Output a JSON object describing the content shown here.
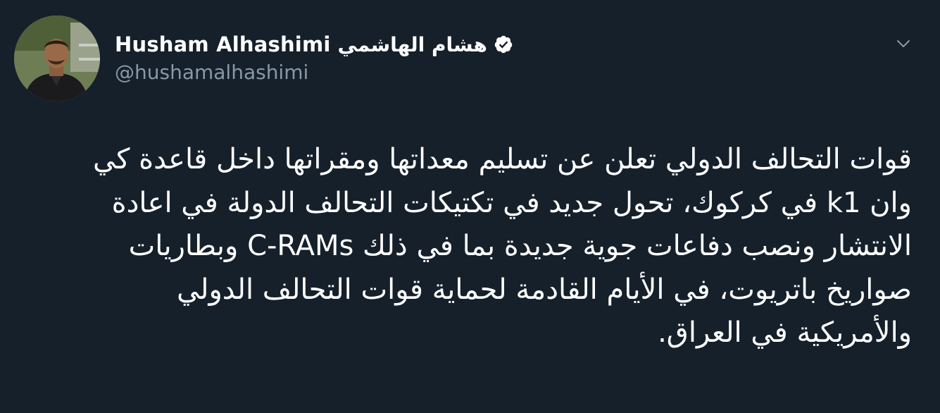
{
  "tweet": {
    "author": {
      "name_en": "Husham Alhashimi",
      "name_ar": "هشام الهاشمي",
      "handle": "@hushamalhashimi",
      "verified": true,
      "avatar_icon": "profile-photo"
    },
    "menu_icon": "chevron-down-icon",
    "text_lines": [
      "قوات التحالف الدولي تعلن عن تسليم معداتها ومقراتها داخل قاعدة كي",
      "وان k1  في كركوك، تحول جديد في تكتيكات التحالف الدولة في اعادة",
      "الانتشار ونصب دفاعات جوية جديدة بما في ذلك C-RAMs وبطاريات",
      "صواريخ باتريوت، في الأيام القادمة لحماية قوات التحالف الدولي",
      "والأمريكية في العراق."
    ]
  },
  "colors": {
    "background": "#15202b",
    "text": "#ffffff",
    "secondary_text": "#8899a6"
  }
}
